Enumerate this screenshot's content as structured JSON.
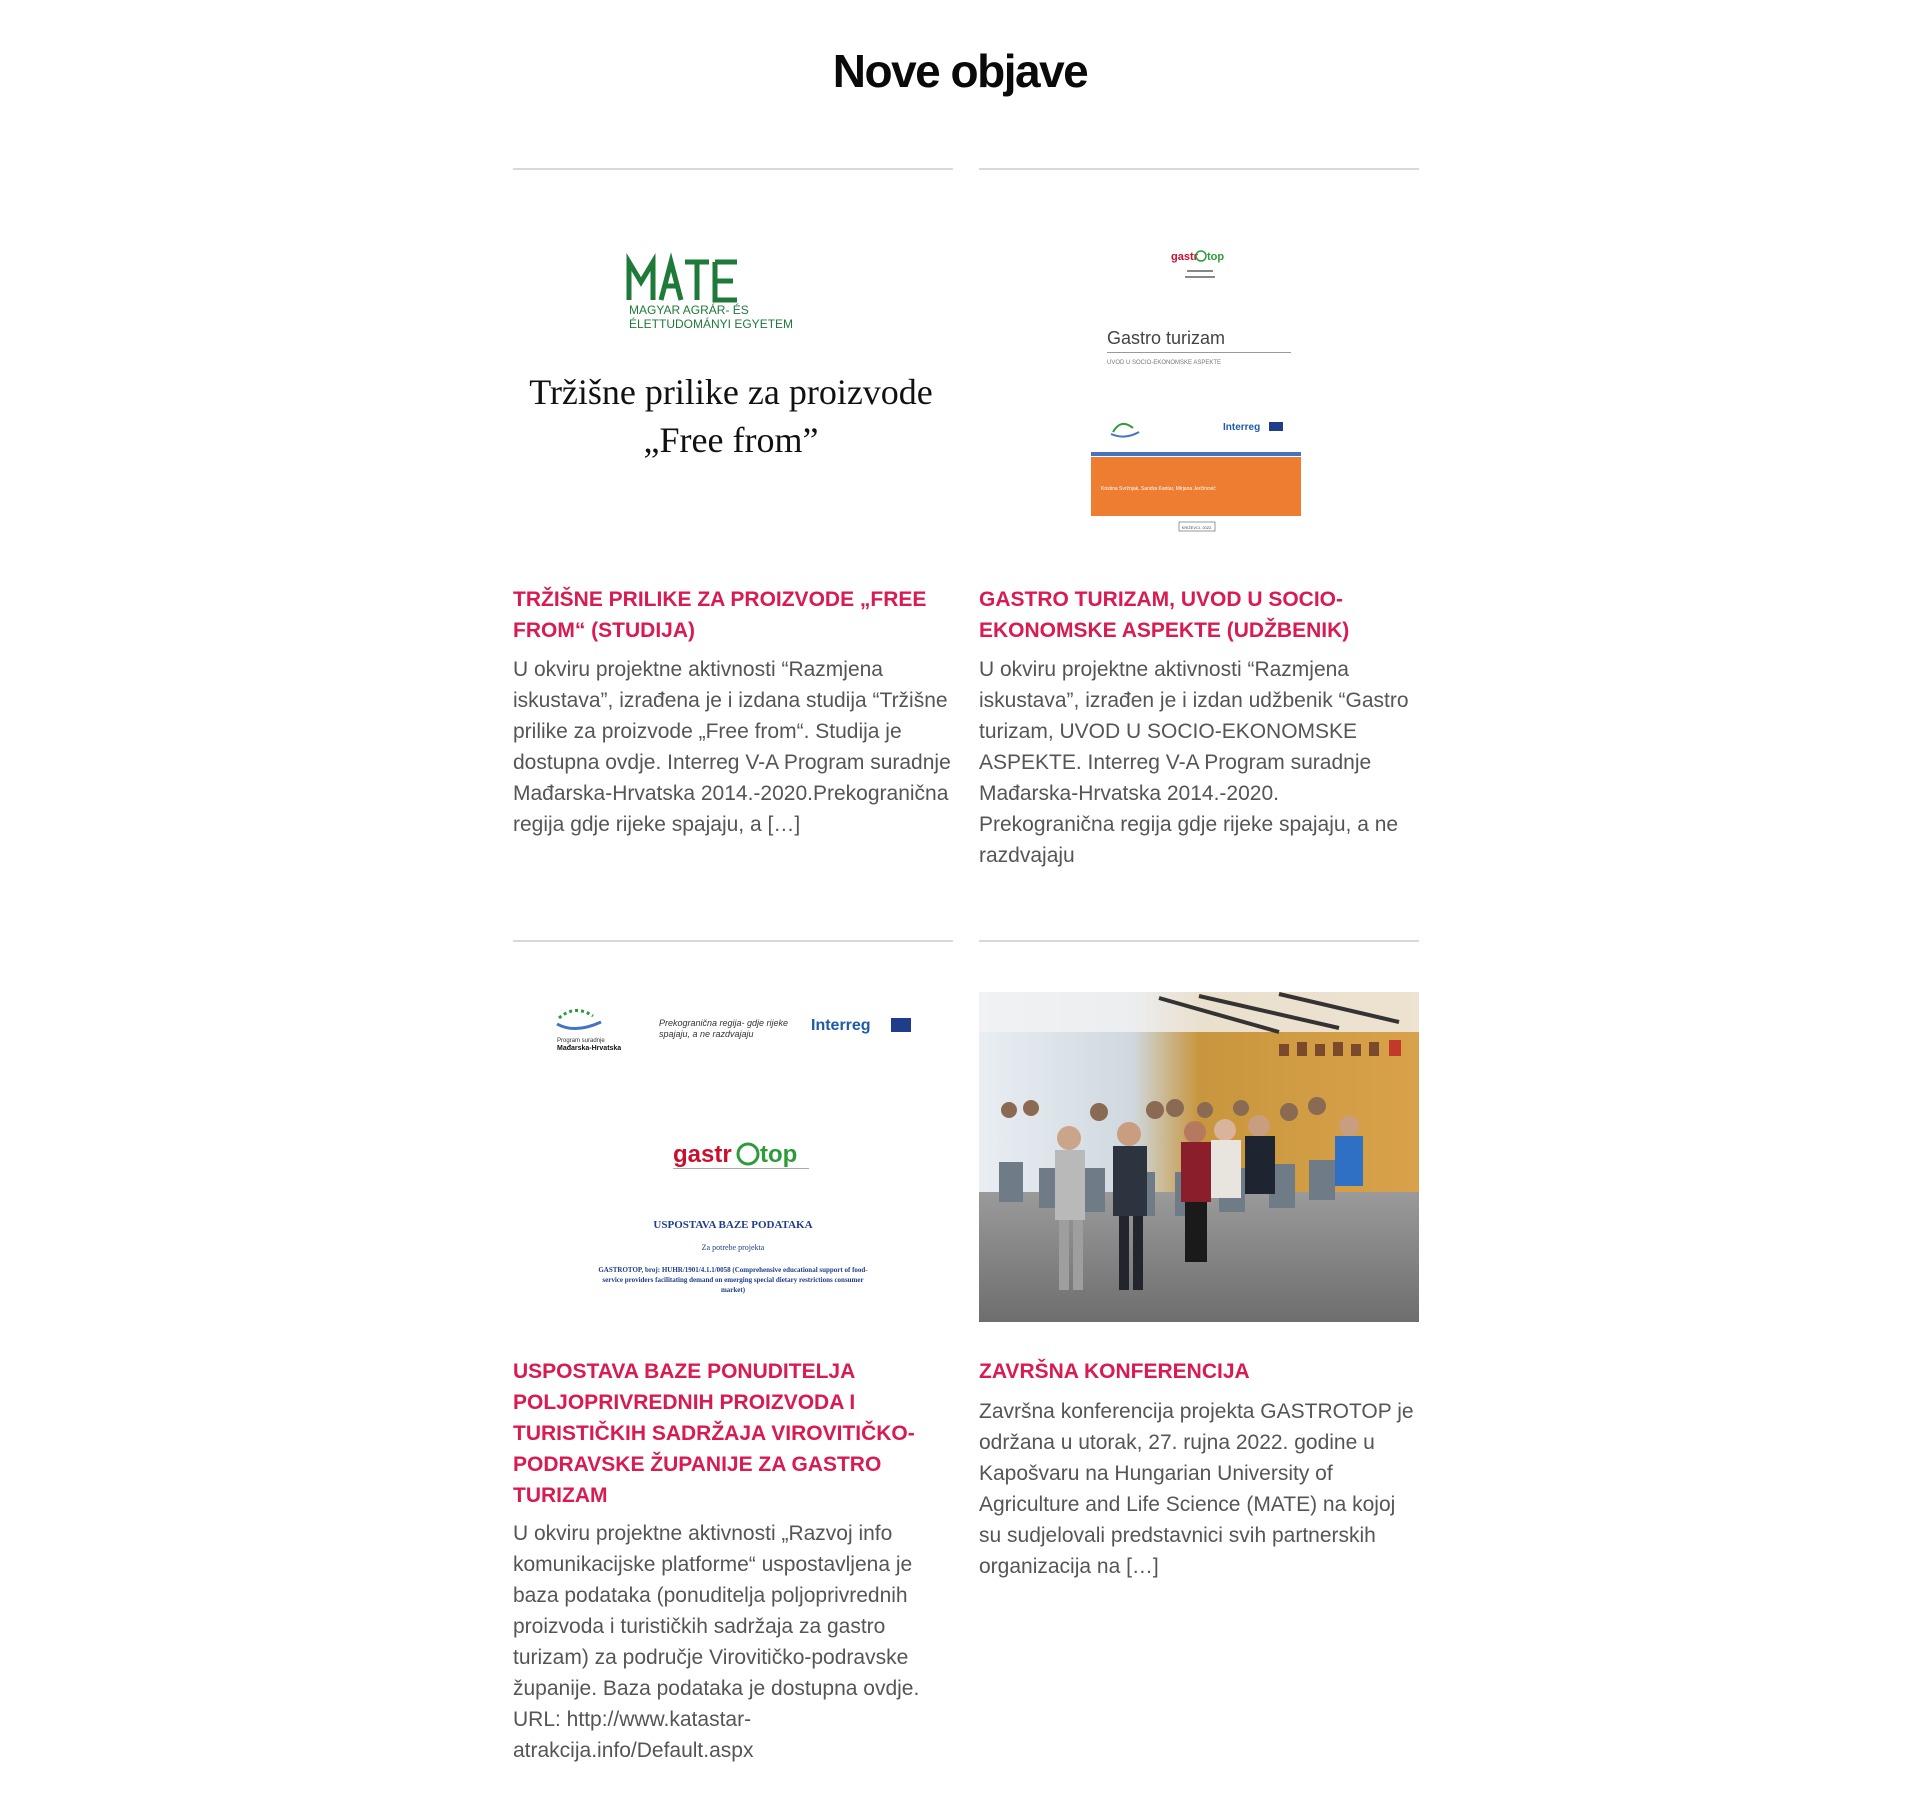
{
  "section": {
    "title": "Nove objave"
  },
  "posts": [
    {
      "title": "Tržišne prilike za proizvode „Free from“ (Studija)",
      "excerpt": "U okviru projektne aktivnosti “Razmjena iskustava”, izrađena je i izdana studija “Tržišne prilike za proizvode „Free from“. Studija je dostupna ovdje. Interreg V-A Program suradnje Mađarska-Hrvatska 2014.-2020.Prekogranična regija gdje rijeke spajaju, a […]",
      "image": {
        "logo_text": "MATE",
        "logo_line1": "MAGYAR AGRÁR- ÉS",
        "logo_line2": "ÉLETTUDOMÁNYI EGYETEM",
        "heading_line1": "Tržišne prilike za proizvode",
        "heading_line2": "„Free from”"
      }
    },
    {
      "title": "Gastro turizam, Uvod u socio-ekonomske aspekte (Udžbenik)",
      "excerpt": "U okviru projektne aktivnosti “Razmjena iskustava”, izrađen je i izdan udžbenik “Gastro turizam, UVOD U SOCIO-EKONOMSKE ASPEKTE. Interreg V-A Program suradnje Mađarska-Hrvatska 2014.-2020. Prekogranična regija gdje rijeke spajaju, a ne razdvajaju",
      "image": {
        "brand_left": "gastr",
        "brand_right": "top",
        "book_title": "Gastro turizam",
        "book_subtitle": "UVOD U SOCIO-EKONOMSKE ASPEKTE",
        "interreg": "Interreg",
        "authors": "Kristina Svržnjak, Sandra Kantar, Mirjana Jerčinović",
        "place": "KRIŽEVCI, 2022."
      }
    },
    {
      "title": "Uspostava baze ponuditelja poljoprivrednih proizvoda i turističkih sadržaja Virovitičko-podravske županije za gastro turizam",
      "excerpt": "U okviru projektne aktivnosti „Razvoj info komunikacijske platforme“ uspostavljena je baza podataka (ponuditelja poljoprivrednih proizvoda i turističkih sadržaja za gastro turizam) za područje Virovitičko-podravske županije. Baza podataka je dostupna ovdje. URL: http://www.katastar-atrakcija.info/Default.aspx",
      "image": {
        "program_line1": "Program suradnje",
        "program_line2": "Mađarska-Hrvatska",
        "slogan_line1": "Prekogranična regija- gdje rijeke",
        "slogan_line2": "spajaju, a ne razdvajaju",
        "interreg": "Interreg",
        "brand_left": "gastr",
        "brand_right": "top",
        "doc_title": "USPOSTAVA BAZE PODATAKA",
        "doc_for": "Za potrebe projekta",
        "doc_line1": "GASTROTOP, broj: HUHR/1901/4.1.1/0058 (Comprehensive educational support of food-",
        "doc_line2": "service providers facilitating demand on emerging special dietary restrictions consumer",
        "doc_line3": "market)"
      }
    },
    {
      "title": "Završna konferencija",
      "excerpt": "Završna konferencija projekta GASTROTOP je održana u utorak, 27. rujna 2022. godine u Kapošvaru na Hungarian University of Agriculture and Life Science (MATE) na kojoj su sudjelovali predstavnici svih partnerskih organizacija na […]",
      "image": {
        "alt": "conference-photo"
      }
    }
  ],
  "colors": {
    "title_accent": "#d81b50",
    "excerpt_text": "#555555",
    "divider": "#d9d9d9",
    "mate_green": "#1f7a3a",
    "gastrotop_red": "#c8102e",
    "gastrotop_green": "#2e9b3a",
    "book_orange": "#ee7d32",
    "book_blue": "#4472c4",
    "doc_blue": "#1f3d8a"
  }
}
